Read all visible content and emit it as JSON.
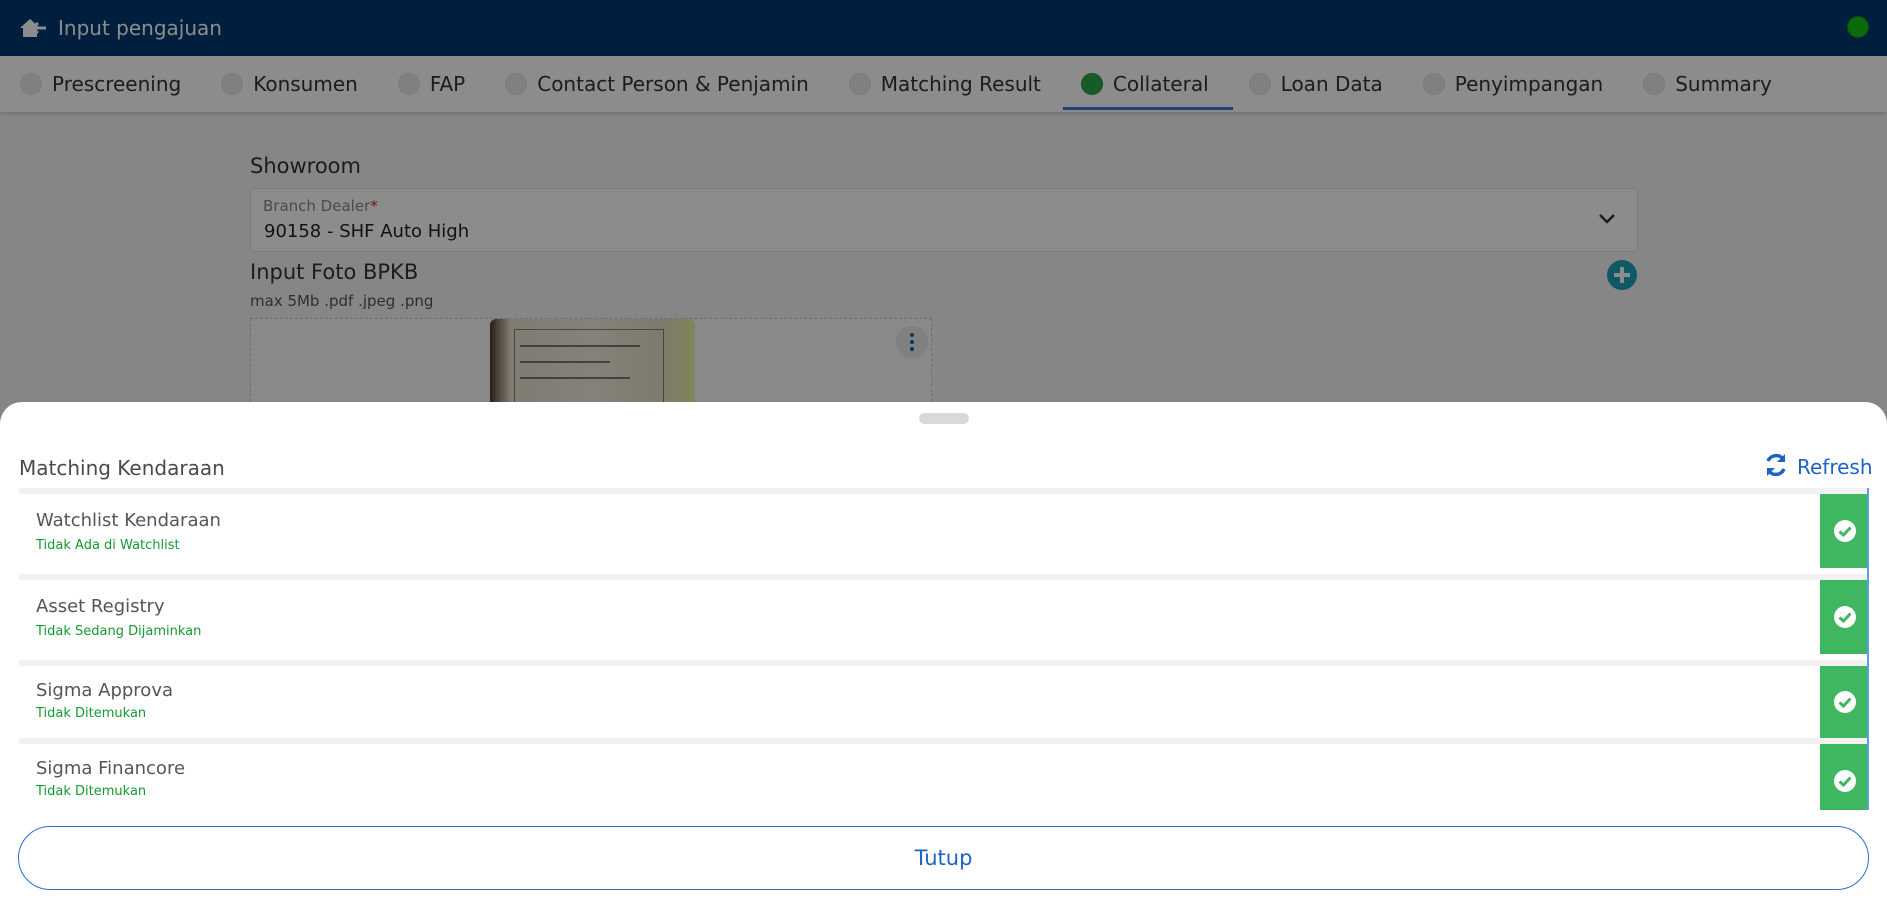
{
  "header": {
    "title": "Input pengajuan",
    "home_icon": "home-back-icon",
    "status_color": "#14c214"
  },
  "tabs": [
    {
      "label": "Prescreening",
      "active": false
    },
    {
      "label": "Konsumen",
      "active": false
    },
    {
      "label": "FAP",
      "active": false
    },
    {
      "label": "Contact Person & Penjamin",
      "active": false
    },
    {
      "label": "Matching Result",
      "active": false
    },
    {
      "label": "Collateral",
      "active": true
    },
    {
      "label": "Loan Data",
      "active": false
    },
    {
      "label": "Penyimpangan",
      "active": false
    },
    {
      "label": "Summary",
      "active": false
    }
  ],
  "showroom": {
    "title": "Showroom",
    "branch_dealer_label": "Branch Dealer",
    "required_mark": "*",
    "branch_dealer_value": "90158 - SHF Auto High"
  },
  "upload": {
    "title": "Input Foto BPKB",
    "hint": "max 5Mb .pdf .jpeg .png"
  },
  "sheet": {
    "title": "Matching Kendaraan",
    "refresh_label": "Refresh",
    "items": [
      {
        "name": "Watchlist Kendaraan",
        "status": "Tidak Ada di Watchlist"
      },
      {
        "name": "Asset Registry",
        "status": "Tidak Sedang Dijaminkan"
      },
      {
        "name": "Sigma Approva",
        "status": "Tidak Ditemukan"
      },
      {
        "name": "Sigma Financore",
        "status": "Tidak Ditemukan"
      }
    ],
    "close_label": "Tutup"
  },
  "colors": {
    "header_bg": "#003a73",
    "accent": "#1d63c4",
    "success": "#3fb761",
    "status_text": "#159a30"
  }
}
